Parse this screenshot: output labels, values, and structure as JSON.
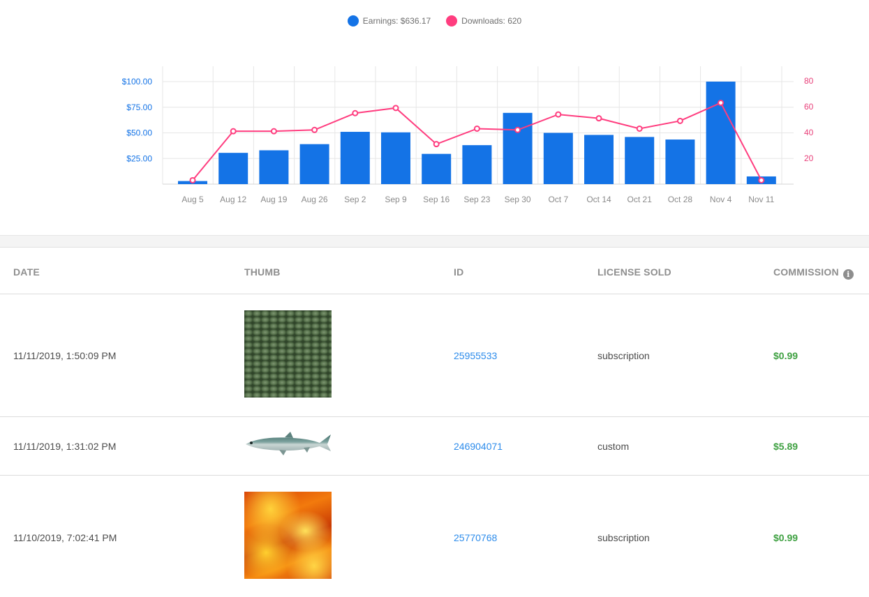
{
  "chart_data": {
    "type": "bar+line",
    "legend_position": "top-center",
    "categories": [
      "Aug 5",
      "Aug 12",
      "Aug 19",
      "Aug 26",
      "Sep 2",
      "Sep 9",
      "Sep 16",
      "Sep 23",
      "Sep 30",
      "Oct 7",
      "Oct 14",
      "Oct 21",
      "Oct 28",
      "Nov 4",
      "Nov 11"
    ],
    "series": [
      {
        "name": "Earnings: $636.17",
        "type": "bar",
        "axis": "left",
        "color": "#1473e6",
        "values": [
          3,
          30.5,
          33,
          39,
          51,
          50.5,
          29.5,
          38,
          69.5,
          50,
          48,
          46,
          43.5,
          100,
          7.5
        ]
      },
      {
        "name": "Downloads: 620",
        "type": "line",
        "axis": "right",
        "color": "#ff3d7f",
        "values": [
          3,
          41,
          41,
          42,
          55,
          59,
          31,
          43,
          42,
          54,
          51,
          43,
          49,
          63,
          3
        ]
      }
    ],
    "y_left": {
      "ticks": [
        "$25.00",
        "$50.00",
        "$75.00",
        "$100.00"
      ],
      "tick_values": [
        25,
        50,
        75,
        100
      ],
      "ylim": [
        0,
        100
      ],
      "color": "#1473e6"
    },
    "y_right": {
      "ticks": [
        "20",
        "40",
        "60",
        "80"
      ],
      "tick_values": [
        20,
        40,
        60,
        80
      ],
      "ylim": [
        0,
        80
      ],
      "color": "#e8417a"
    },
    "grid": true
  },
  "table": {
    "headers": {
      "date": "DATE",
      "thumb": "THUMB",
      "id": "ID",
      "license": "LICENSE SOLD",
      "commission": "COMMISSION"
    },
    "info_icon": "info-icon",
    "rows": [
      {
        "date": "11/11/2019, 1:50:09 PM",
        "thumb": "green-reptile-scales-texture",
        "id": "25955533",
        "license": "subscription",
        "commission": "$0.99"
      },
      {
        "date": "11/11/2019, 1:31:02 PM",
        "thumb": "fish-image",
        "id": "246904071",
        "license": "custom",
        "commission": "$5.89"
      },
      {
        "date": "11/10/2019, 7:02:41 PM",
        "thumb": "fire-flames-texture",
        "id": "25770768",
        "license": "subscription",
        "commission": "$0.99"
      }
    ]
  }
}
